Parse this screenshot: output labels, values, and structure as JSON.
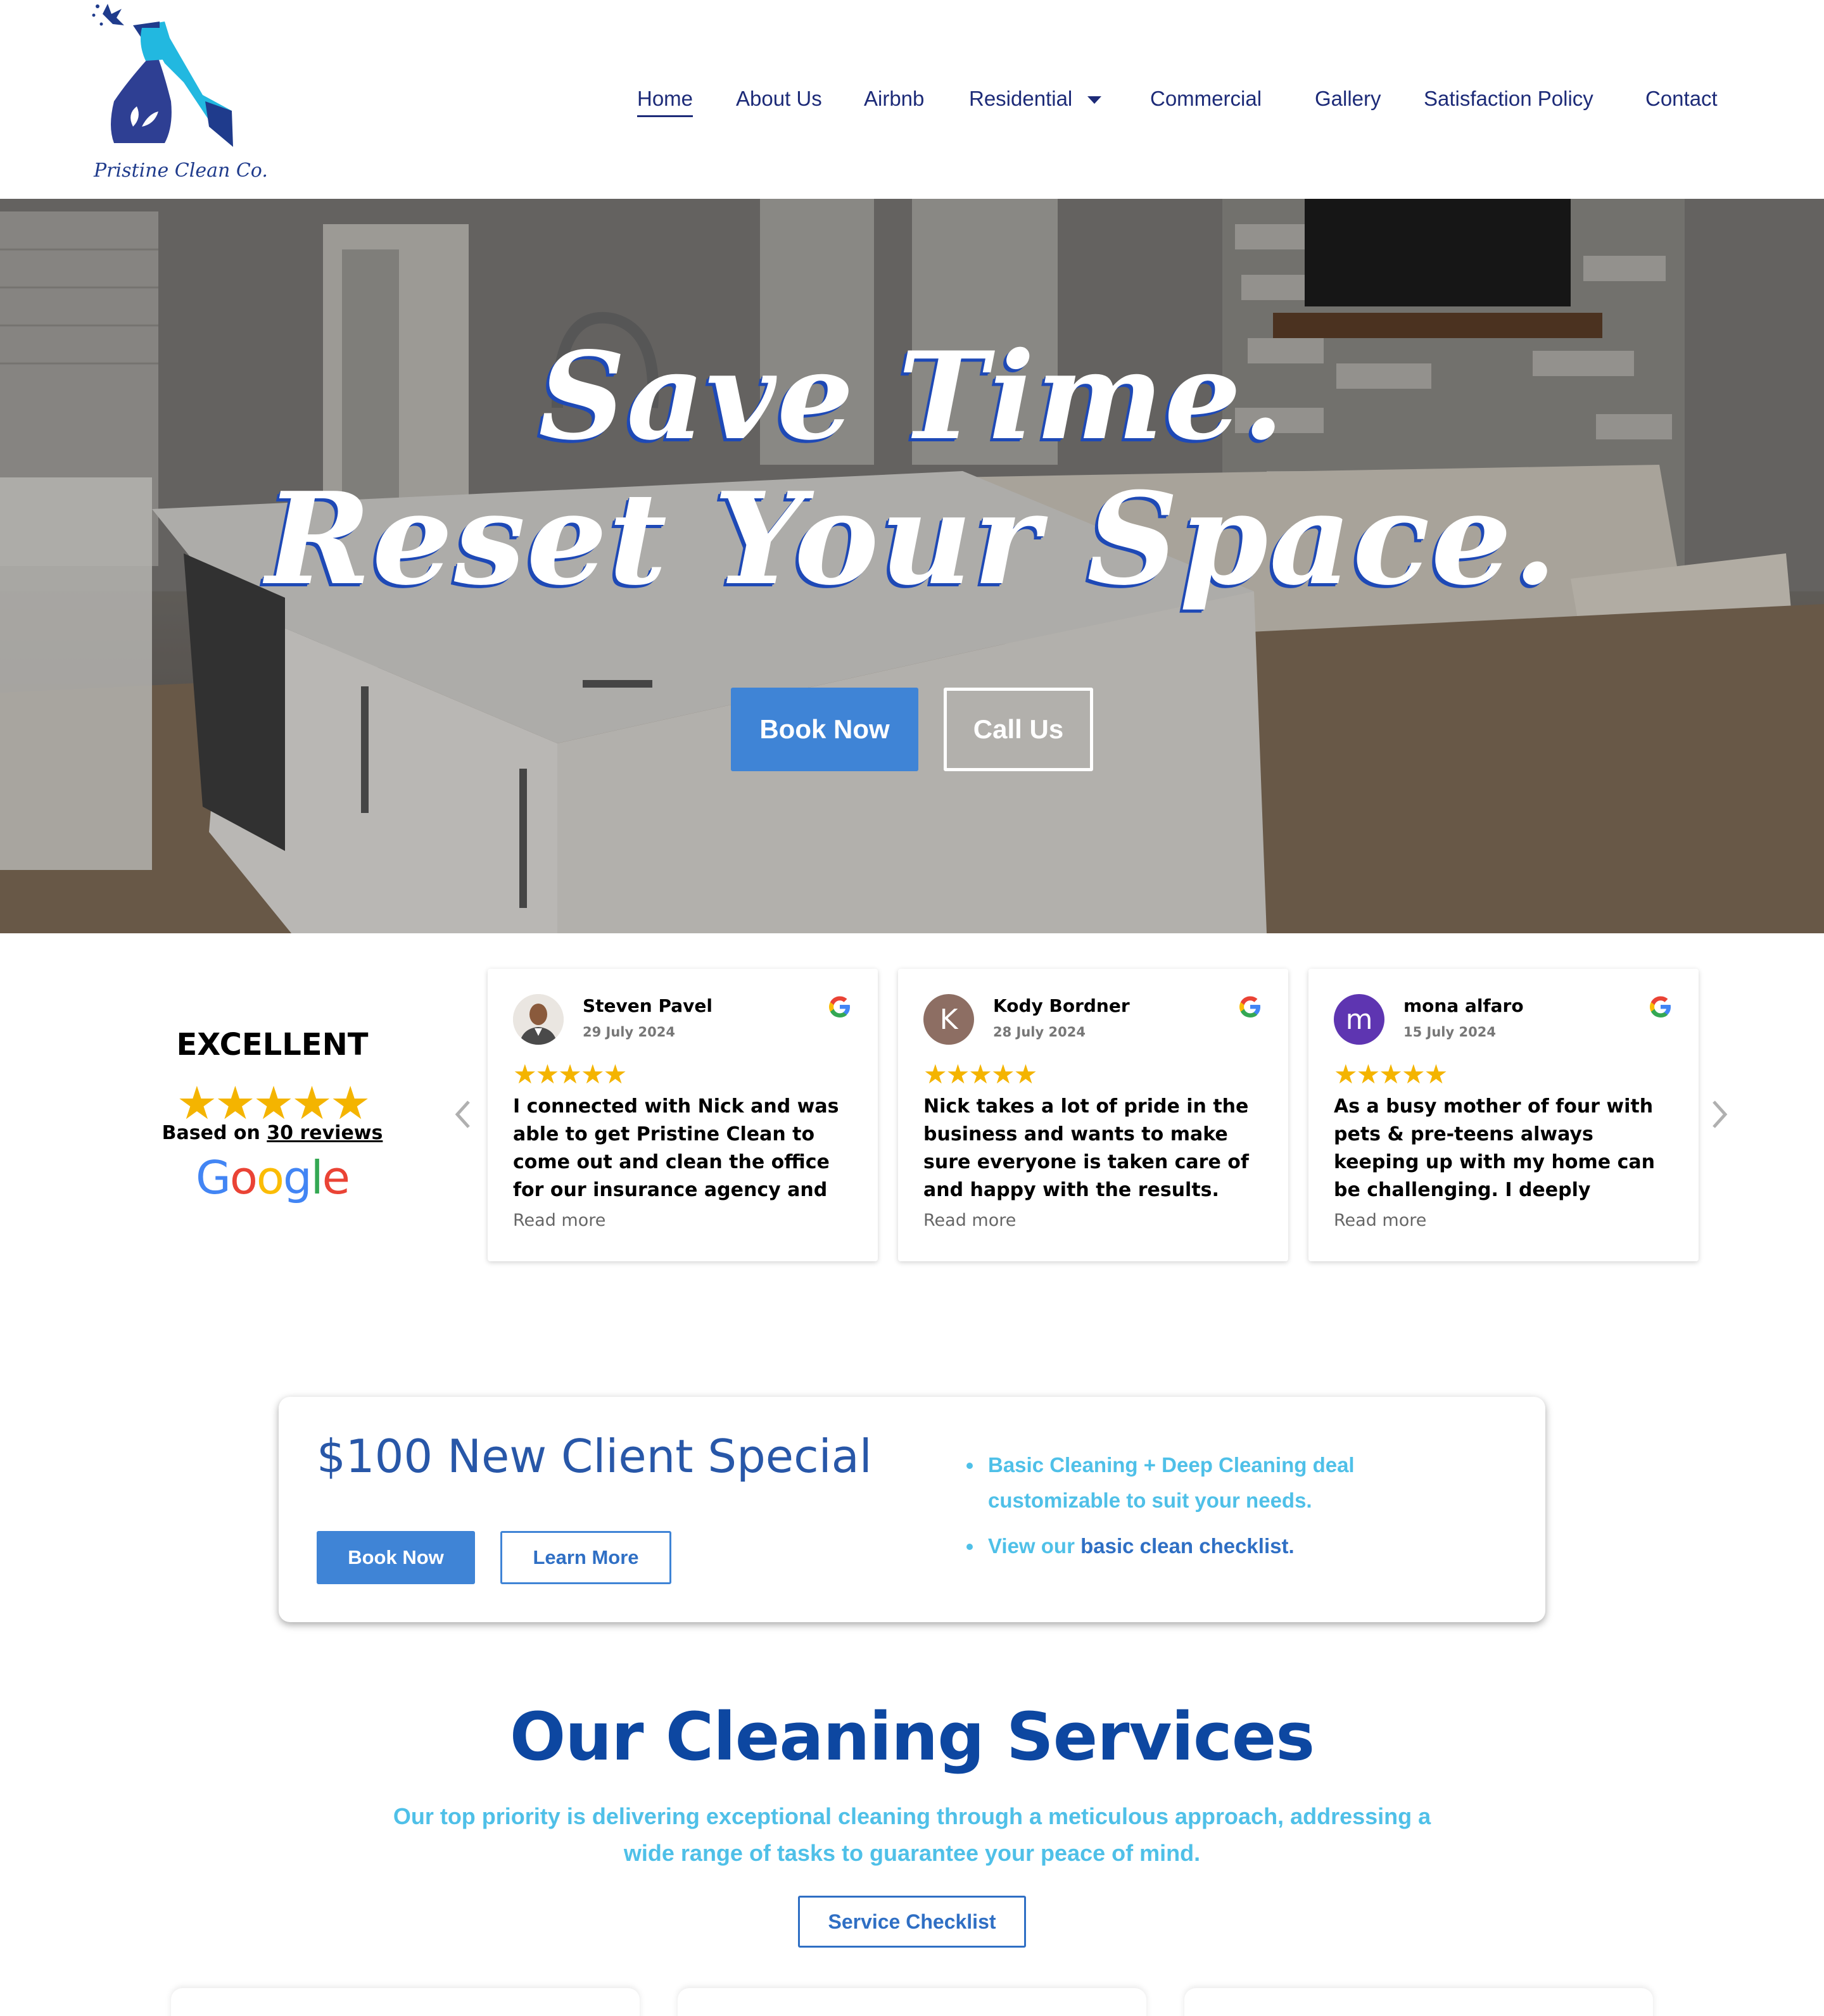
{
  "brand": {
    "name": "Pristine Clean Co."
  },
  "nav": {
    "items": [
      {
        "label": "Home",
        "active": true
      },
      {
        "label": "About Us"
      },
      {
        "label": "Airbnb"
      },
      {
        "label": "Residential",
        "has_dropdown": true
      },
      {
        "label": "Commercial"
      },
      {
        "label": "Gallery"
      },
      {
        "label": "Satisfaction Policy"
      },
      {
        "label": "Contact"
      }
    ]
  },
  "hero": {
    "line1": "Save Time.",
    "line2": "Reset Your Space.",
    "book_label": "Book Now",
    "call_label": "Call Us"
  },
  "reviews": {
    "rating_word": "EXCELLENT",
    "stars": "★★★★★",
    "based_on_prefix": "Based on",
    "based_on_link": "30 reviews",
    "google_word": "Google",
    "items": [
      {
        "name": "Steven Pavel",
        "date": "29 July 2024",
        "stars": "★★★★★",
        "text": "I connected with Nick and was able to get Pristine Clean to come out and clean the office for our insurance agency and they did an…",
        "read_more": "Read more",
        "avatar_letter": "",
        "avatar_color": "#6b5a4e"
      },
      {
        "name": "Kody Bordner",
        "date": "28 July 2024",
        "stars": "★★★★★",
        "text": "Nick takes a lot of pride in the business and wants to make sure everyone is taken care of and happy with the results. Very easy…",
        "read_more": "Read more",
        "avatar_letter": "K",
        "avatar_color": "#8d6e63"
      },
      {
        "name": "mona alfaro",
        "date": "15 July 2024",
        "stars": "★★★★★",
        "text": "As a busy mother of four with pets & pre-teens always keeping up with my home can be challenging. I deeply appreciate the dedication…",
        "read_more": "Read more",
        "avatar_letter": "m",
        "avatar_color": "#5e35b1"
      }
    ]
  },
  "special": {
    "title": "$100 New Client Special",
    "book_label": "Book Now",
    "learn_label": "Learn More",
    "bullet1": "Basic Cleaning + Deep Cleaning deal customizable to suit your needs.",
    "bullet2_prefix": "View our",
    "bullet2_link": "basic clean checklist."
  },
  "services": {
    "title": "Our Cleaning Services",
    "subtitle": "Our top priority is delivering exceptional cleaning through a meticulous approach, addressing a wide range of tasks to guarantee your peace of mind.",
    "checklist_label": "Service Checklist"
  },
  "colors": {
    "primary_blue": "#3f84d6",
    "navy": "#1d2b78",
    "heading_blue": "#0d47a1",
    "light_blue": "#4fc0e8",
    "star_gold": "#f4b400"
  }
}
